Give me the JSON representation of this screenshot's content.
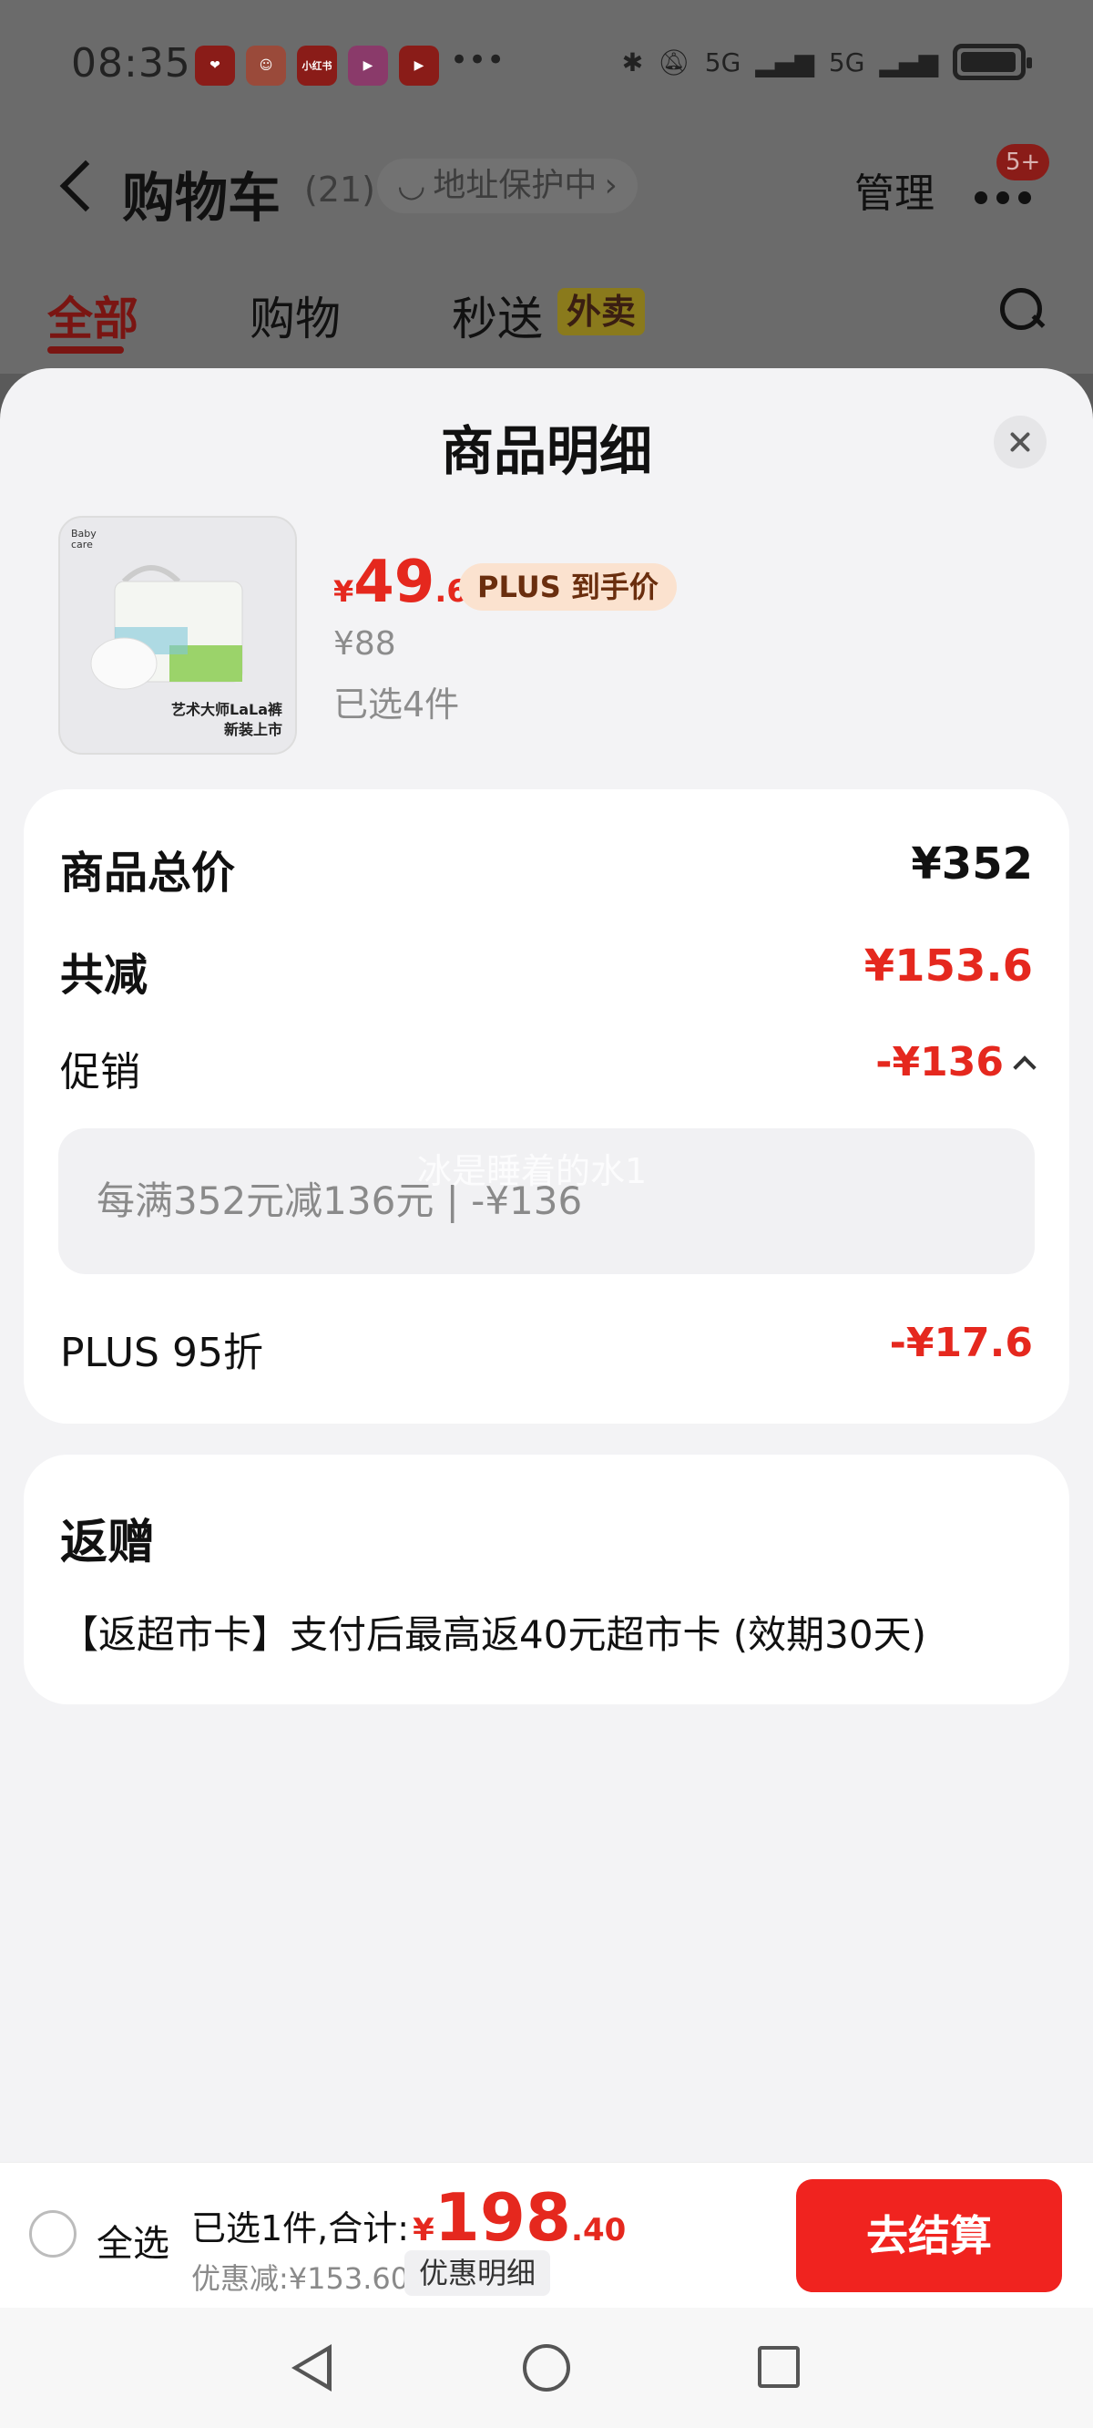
{
  "status_bar": {
    "time": "08:35",
    "apps": [
      {
        "name": "app-icon-1",
        "color": "#8a1c18",
        "glyph": "❤"
      },
      {
        "name": "app-icon-2",
        "color": "#9a4a3a",
        "glyph": "☺"
      },
      {
        "name": "xiaohongshu-icon",
        "color": "#8a1c18",
        "glyph": "小红书"
      },
      {
        "name": "video-app-icon",
        "color": "#8a3a6a",
        "glyph": "▶"
      },
      {
        "name": "short-video-icon",
        "color": "#8a1c18",
        "glyph": "▶"
      }
    ],
    "more": "•••",
    "signal_1": "5G",
    "signal_2": "5G"
  },
  "header": {
    "title": "购物车",
    "count": "(21)",
    "address": "地址保护中",
    "manage": "管理",
    "badge": "5+"
  },
  "tabs": [
    {
      "label": "全部"
    },
    {
      "label": "购物"
    },
    {
      "label": "秒送"
    }
  ],
  "tab_tag": "外卖",
  "sheet": {
    "title": "商品明细"
  },
  "product": {
    "brand": "Baby care",
    "caption_line1": "艺术大师LaLa裤",
    "caption_line2": "新装上市",
    "price_symbol": "¥",
    "price_int": "49",
    "price_dec": ".6",
    "plus_tag": "PLUS 到手价",
    "original_price": "¥88",
    "selected": "已选4件"
  },
  "breakdown": {
    "total_label": "商品总价",
    "total_value": "¥352",
    "reduce_label": "共减",
    "reduce_value": "¥153.6",
    "promo_label": "促销",
    "promo_value": "-¥136",
    "promo_detail": "每满352元减136元 | -¥136",
    "watermark": "冰是睡着的水1",
    "plus_label": "PLUS 95折",
    "plus_value": "-¥17.6"
  },
  "gift": {
    "title": "返赠",
    "text": "【返超市卡】支付后最高返40元超市卡 (效期30天)"
  },
  "bottom_bar": {
    "select_all": "全选",
    "selected_summary": "已选1件,合计:",
    "total_symbol": "¥",
    "total_int": "198",
    "total_dec": ".40",
    "discount": "优惠减:¥153.60",
    "discount_detail_btn": "优惠明细",
    "checkout": "去结算"
  },
  "colors": {
    "accent_red": "#e5281e",
    "checkout_red": "#f0231f",
    "plus_tag_bg": "#fbe2cf"
  }
}
